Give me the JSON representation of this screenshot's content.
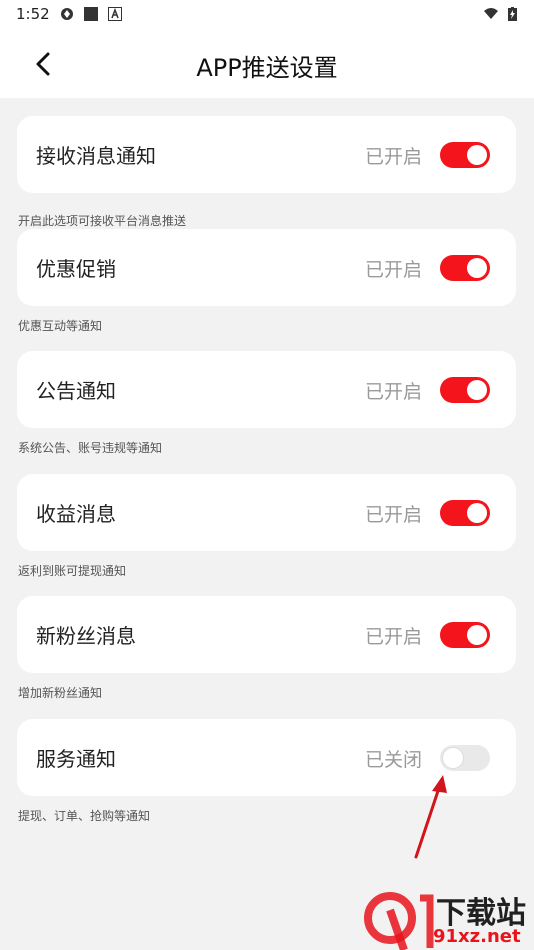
{
  "status_bar": {
    "time": "1:52"
  },
  "header": {
    "title": "APP推送设置"
  },
  "settings": [
    {
      "label": "接收消息通知",
      "status": "已开启",
      "enabled": true,
      "desc": "开启此选项可接收平台消息推送"
    },
    {
      "label": "优惠促销",
      "status": "已开启",
      "enabled": true,
      "desc": "优惠互动等通知"
    },
    {
      "label": "公告通知",
      "status": "已开启",
      "enabled": true,
      "desc": "系统公告、账号违规等通知"
    },
    {
      "label": "收益消息",
      "status": "已开启",
      "enabled": true,
      "desc": "返利到账可提现通知"
    },
    {
      "label": "新粉丝消息",
      "status": "已开启",
      "enabled": true,
      "desc": "增加新粉丝通知"
    },
    {
      "label": "服务通知",
      "status": "已关闭",
      "enabled": false,
      "desc": "提现、订单、抢购等通知"
    }
  ],
  "watermark": {
    "text": "下载站",
    "url": "91xz.net"
  },
  "colors": {
    "accent": "#f4141c",
    "toggle_off": "#e9e9e9",
    "background": "#f2f2f2",
    "annotation_arrow": "#d0161c"
  }
}
